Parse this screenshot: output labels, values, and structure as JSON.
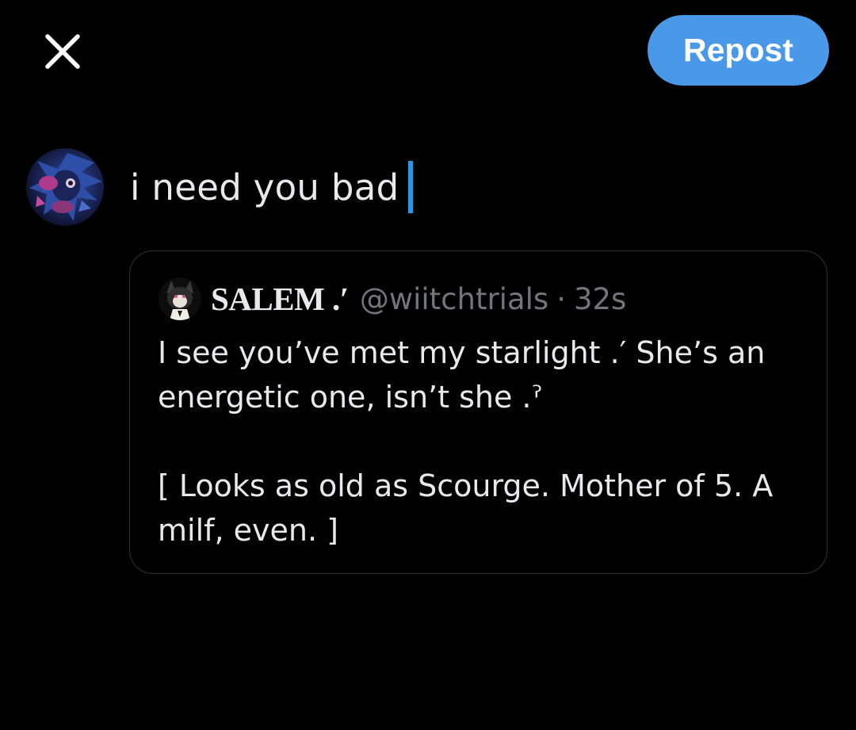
{
  "header": {
    "close_icon": "close-icon",
    "repost_label": "Repost",
    "repost_color": "#4a99e9"
  },
  "composer": {
    "text": "i need you bad",
    "avatar_icon": "user-avatar",
    "caret_color": "#1d9bf0"
  },
  "quoted_post": {
    "display_name": "SALEM .′",
    "handle": "@wiitchtrials",
    "separator": "·",
    "timestamp": "32s",
    "avatar_icon": "quoted-user-avatar",
    "body_lines": [
      "I see you’ve met my starlight .′ She’s an energetic one, isn’t she .ˀ",
      "[ Looks as old as Scourge. Mother of 5. A milf, even. ]"
    ]
  }
}
